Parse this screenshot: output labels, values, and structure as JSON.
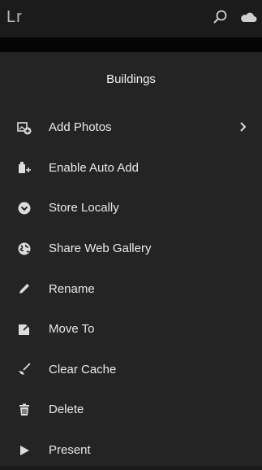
{
  "app": {
    "logo": "Lr"
  },
  "top_icons": [
    "search-icon",
    "cloud-icon"
  ],
  "panel": {
    "title": "Buildings"
  },
  "menu": [
    {
      "label": "Add Photos",
      "icon": "add-photos-icon",
      "has_submenu": true
    },
    {
      "label": "Enable Auto Add",
      "icon": "auto-add-icon"
    },
    {
      "label": "Store Locally",
      "icon": "store-locally-icon"
    },
    {
      "label": "Share Web Gallery",
      "icon": "share-globe-icon"
    },
    {
      "label": "Rename",
      "icon": "pencil-icon"
    },
    {
      "label": "Move To",
      "icon": "move-to-icon"
    },
    {
      "label": "Clear Cache",
      "icon": "broom-icon"
    },
    {
      "label": "Delete",
      "icon": "trash-icon"
    },
    {
      "label": "Present",
      "icon": "play-icon"
    }
  ]
}
